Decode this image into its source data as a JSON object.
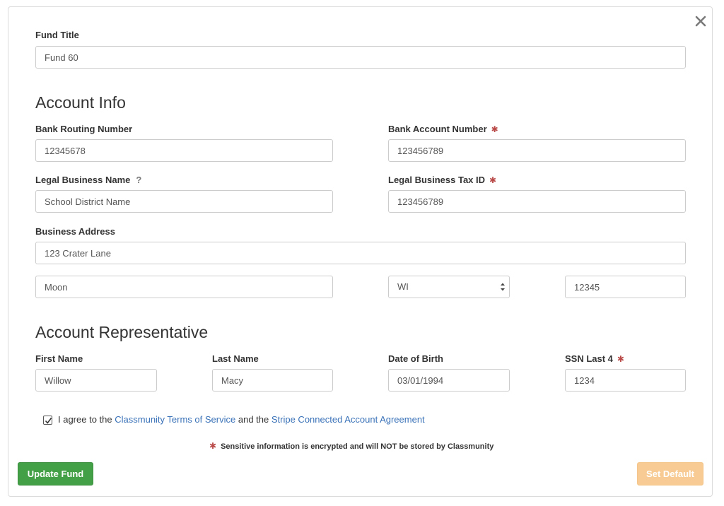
{
  "fund": {
    "title_label": "Fund Title",
    "title_value": "Fund 60"
  },
  "account_info": {
    "heading": "Account Info",
    "routing_label": "Bank Routing Number",
    "routing_value": "12345678",
    "account_number_label": "Bank Account Number",
    "account_number_value": "123456789",
    "business_name_label": "Legal Business Name",
    "business_name_help": "?",
    "business_name_value": "School District Name",
    "tax_id_label": "Legal Business Tax ID",
    "tax_id_value": "123456789",
    "address_label": "Business Address",
    "address_value": "123 Crater Lane",
    "city_value": "Moon",
    "state_value": "WI",
    "zip_value": "12345"
  },
  "representative": {
    "heading": "Account Representative",
    "first_name_label": "First Name",
    "first_name_value": "Willow",
    "last_name_label": "Last Name",
    "last_name_value": "Macy",
    "dob_label": "Date of Birth",
    "dob_value": "03/01/1994",
    "ssn_label": "SSN Last 4",
    "ssn_value": "1234"
  },
  "agreement": {
    "checked": true,
    "prefix": "I agree to the",
    "terms_link": "Classmunity Terms of Service",
    "middle": "and the",
    "stripe_link": "Stripe Connected Account Agreement"
  },
  "required_marker": "✱",
  "note": "Sensitive information is encrypted and will NOT be stored by Classmunity",
  "buttons": {
    "update": "Update Fund",
    "set_default": "Set Default"
  },
  "colors": {
    "required": "#b94a48",
    "link": "#3a72b8",
    "update_button": "#43a047",
    "default_button": "#f7c98e"
  },
  "icons": {
    "close": "close-icon",
    "checkbox": "checkmark-icon",
    "select": "select-arrows-icon"
  }
}
